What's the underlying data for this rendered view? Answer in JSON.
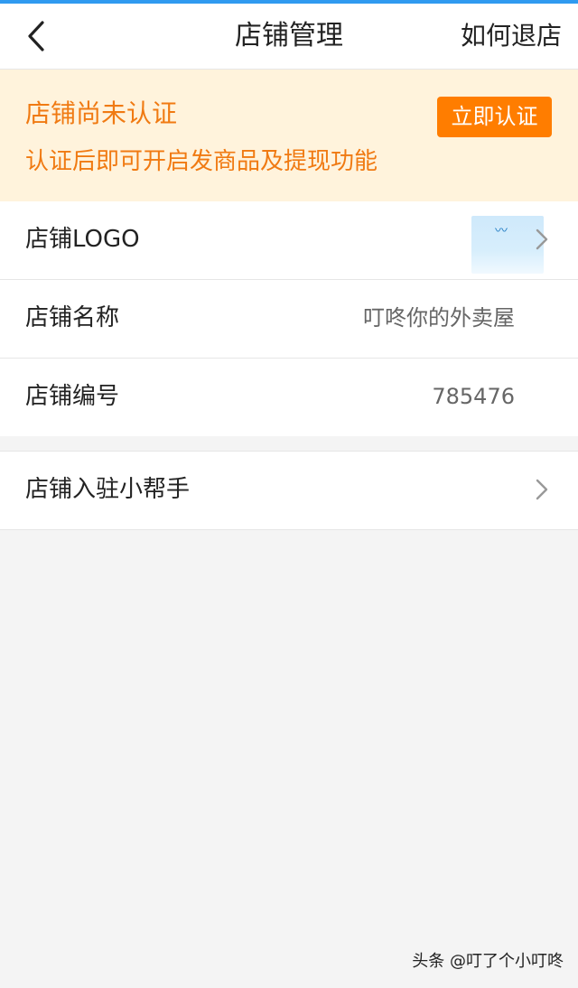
{
  "nav": {
    "title": "店铺管理",
    "right_label": "如何退店"
  },
  "certification": {
    "title": "店铺尚未认证",
    "description": "认证后即可开启发商品及提现功能",
    "button_label": "立即认证"
  },
  "store": {
    "rows": [
      {
        "label": "店铺LOGO"
      },
      {
        "label": "店铺名称",
        "value": "叮咚你的外卖屋"
      },
      {
        "label": "店铺编号",
        "value": "785476"
      }
    ]
  },
  "helper": {
    "label": "店铺入驻小帮手"
  },
  "footer": {
    "watermark": "头条 @叮了个小叮咚"
  },
  "colors": {
    "accent_orange": "#f07a12",
    "button_orange": "#ff7d00",
    "cert_bg": "#fff3dc",
    "top_blue": "#2f9af0"
  },
  "icons": {
    "back": "chevron-left-icon",
    "row_arrow": "chevron-right-icon"
  }
}
